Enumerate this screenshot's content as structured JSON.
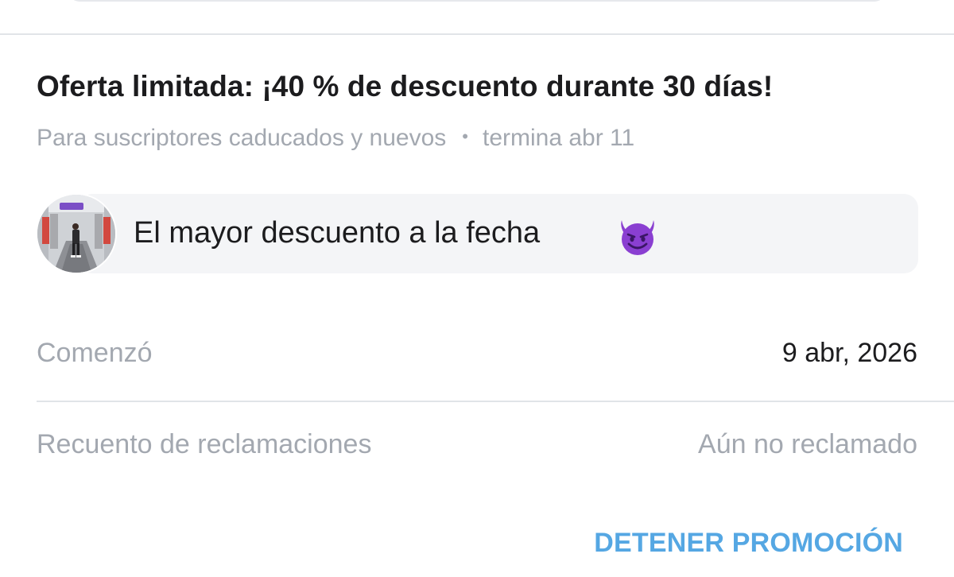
{
  "offer": {
    "title": "Oferta limitada: ¡40 % de descuento durante 30 días!",
    "audience": "Para suscriptores caducados y nuevos",
    "separator": "•",
    "ends": "termina abr 11"
  },
  "message": {
    "text": "El mayor descuento a la fecha",
    "emoji_icon": "smiling-face-with-horns-icon"
  },
  "details": {
    "started_label": "Comenzó",
    "started_value": "9 abr, 2026",
    "claims_label": "Recuento de reclamaciones",
    "claims_value": "Aún no reclamado"
  },
  "actions": {
    "stop_label": "DETENER PROMOCIÓN"
  },
  "colors": {
    "accent": "#55a7e3",
    "muted_text": "#a3a8b0",
    "divider": "#e1e4e8",
    "bubble_bg": "#f4f5f7",
    "devil_purple": "#8a3fd1"
  }
}
